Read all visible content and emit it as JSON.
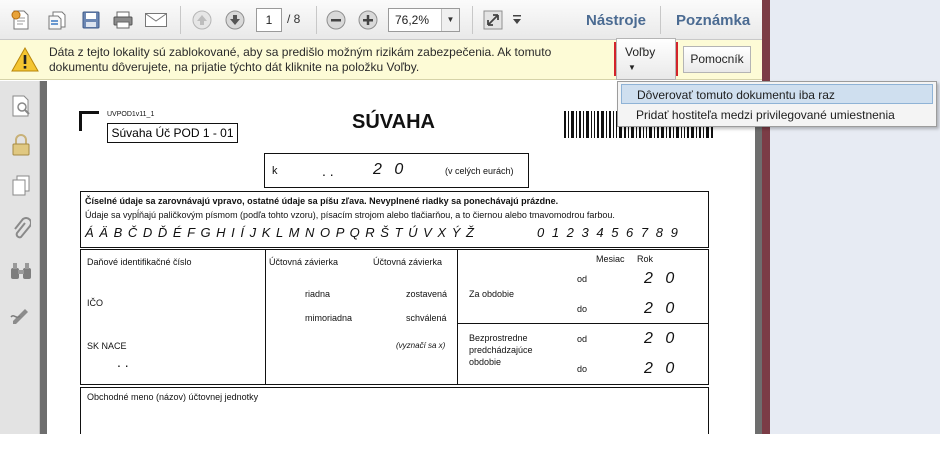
{
  "toolbar": {
    "page_current": "1",
    "page_total": "/ 8",
    "zoom": "76,2%",
    "tools_label": "Nástroje",
    "comment_label": "Poznámka"
  },
  "security_bar": {
    "message": "Dáta z tejto lokality sú zablokované, aby sa predišlo možným rizikám zabezpečenia. Ak tomuto dokumentu dôverujete, na prijatie týchto dát kliknite na položku Voľby.",
    "options_button": "Voľby",
    "help_button": "Pomocník"
  },
  "options_menu": {
    "items": [
      "Dôverovať tomuto dokumentu iba raz",
      "Pridať hostiteľa medzi privilegované umiestnenia"
    ]
  },
  "form": {
    "form_code": "UVPOD1v11_1",
    "subtitle": "Súvaha Úč POD 1 - 01",
    "title": "SÚVAHA",
    "k_label": "k",
    "k_dots": ".        .",
    "k_year": "2 0",
    "k_unit": "(v celých eurách)",
    "instructions_bold": "Číselné údaje sa zarovnávajú vpravo, ostatné údaje sa píšu zľava. Nevyplnené riadky sa ponechávajú prázdne.",
    "instructions": "Údaje sa vypĺňajú paličkovým písmom (podľa tohto vzoru), písacím strojom alebo tlačiarňou, a to čiernou alebo tmavomodrou farbou.",
    "sample_letters": "Á Ä B Č D Ď É F G H I Í J K L M N O P Q R Š T Ú V X Ý Ž",
    "sample_digits": "0 1 2 3 4 5 6 7 8 9",
    "dic_label": "Daňové identifikačné číslo",
    "ico_label": "IČO",
    "sknace_label": "SK NACE",
    "sknace_dots": ".        .",
    "uz_label_1": "Účtovná závierka",
    "uz_label_2": "Účtovná závierka",
    "riadna": "riadna",
    "zostavena": "zostavená",
    "mimoriadna": "mimoriadna",
    "schvalena": "schválená",
    "vyznaci": "(vyznačí sa x)",
    "mesiac": "Mesiac",
    "rok": "Rok",
    "za_obdobie": "Za obdobie",
    "bezprostredne": "Bezprostredne",
    "predchadzajuce": "predchádzajúce",
    "obdobie": "obdobie",
    "od": "od",
    "do": "do",
    "year_prefix": "2 0",
    "obchodne_meno": "Obchodné meno (názov) účtovnej jednotky"
  }
}
